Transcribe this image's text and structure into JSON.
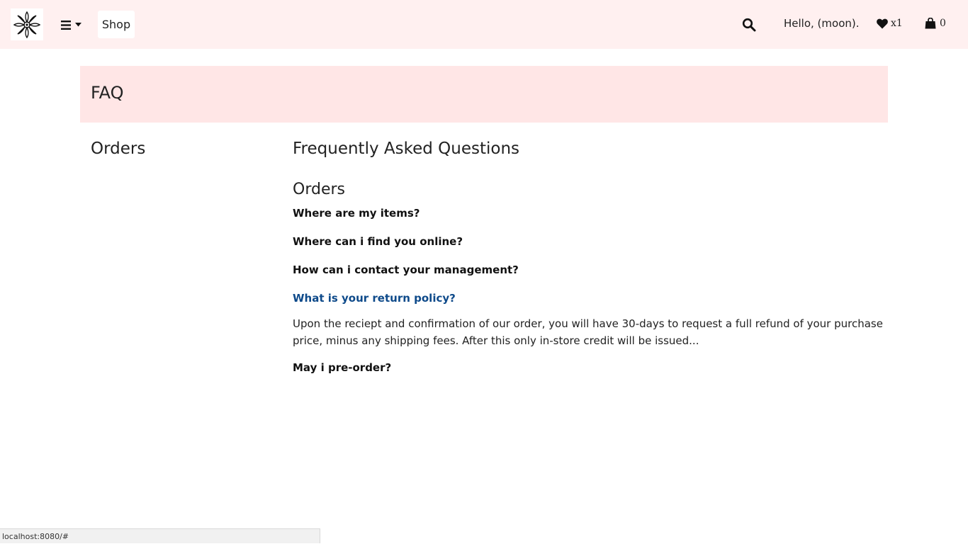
{
  "navbar": {
    "logo_icon": "mandala-logo-icon",
    "menu_icon": "hamburger-icon",
    "shop_label": "Shop",
    "search_icon": "search-icon",
    "greeting": "Hello, (moon).",
    "wishlist_count": "x1",
    "cart_count": "0"
  },
  "banner": {
    "title": "FAQ"
  },
  "sidebar": {
    "title": "Orders"
  },
  "main": {
    "title": "Frequently Asked Questions",
    "section_title": "Orders",
    "questions": [
      {
        "question": "Where are my items?"
      },
      {
        "question": "Where can i find you online?"
      },
      {
        "question": "How can i contact your management?"
      },
      {
        "question": "What is your return policy?",
        "answer": "Upon the reciept and confirmation of our order, you will have 30-days to request a full refund of your purchase price, minus any shipping fees. After this only in-store credit will be issued..."
      },
      {
        "question": "May i pre-order?"
      }
    ]
  },
  "status_bar": {
    "url": "localhost:8080/#"
  },
  "colors": {
    "navbar_bg": "#fff0f0",
    "banner_bg": "#ffe6e6",
    "active_link": "#0e4a8a"
  }
}
